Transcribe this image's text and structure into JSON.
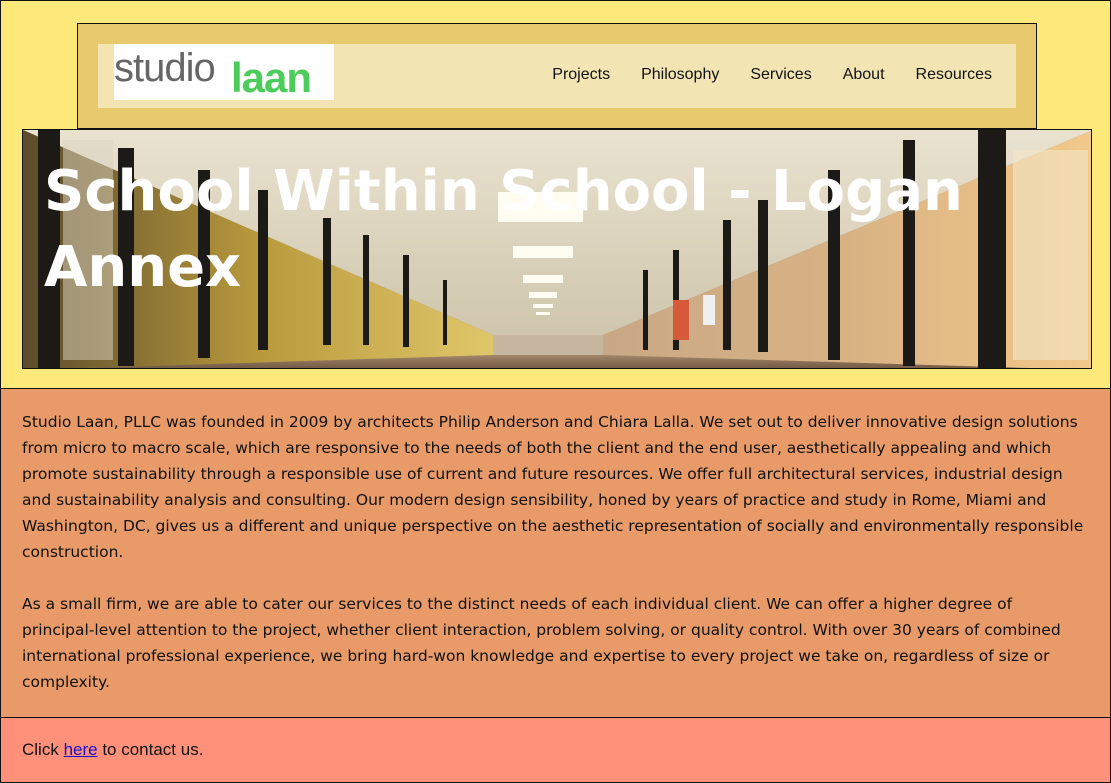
{
  "header": {
    "logo": {
      "studio": "studio",
      "laan": "laan"
    },
    "nav": [
      {
        "label": "Projects"
      },
      {
        "label": "Philosophy"
      },
      {
        "label": "Services"
      },
      {
        "label": "About"
      },
      {
        "label": "Resources"
      }
    ]
  },
  "hero": {
    "title": "School Within School - Logan Annex"
  },
  "about": {
    "paragraphs": [
      "Studio Laan, PLLC was founded in 2009 by architects Philip Anderson and Chiara Lalla. We set out to deliver innovative design solutions from micro to macro scale, which are responsive to the needs of both the client and the end user, aesthetically appealing and which promote sustainability through a responsible use of current and future resources. We offer full architectural services, industrial design and sustainability analysis and consulting. Our modern design sensibility, honed by years of practice and study in Rome, Miami and Washington, DC, gives us a different and unique perspective on the aesthetic representation of socially and environmentally responsible construction.",
      "As a small firm, we are able to cater our services to the distinct needs of each individual client. We can offer a higher degree of principal-level attention to the project, whether client interaction, problem solving, or quality control. With over 30 years of combined international professional experience, we bring hard-won knowledge and expertise to every project we take on, regardless of size or complexity."
    ]
  },
  "contact": {
    "prefix": "Click ",
    "link_text": "here",
    "suffix": " to contact us."
  },
  "colors": {
    "top_bg": "#fde97a",
    "header_bg": "#e8c96d",
    "header_inner_bg": "#f2e5b3",
    "about_bg": "#e89a69",
    "contact_bg": "#ff917a",
    "logo_grey": "#666666",
    "logo_green": "#4ccc5a",
    "link": "#1a0dcc"
  }
}
